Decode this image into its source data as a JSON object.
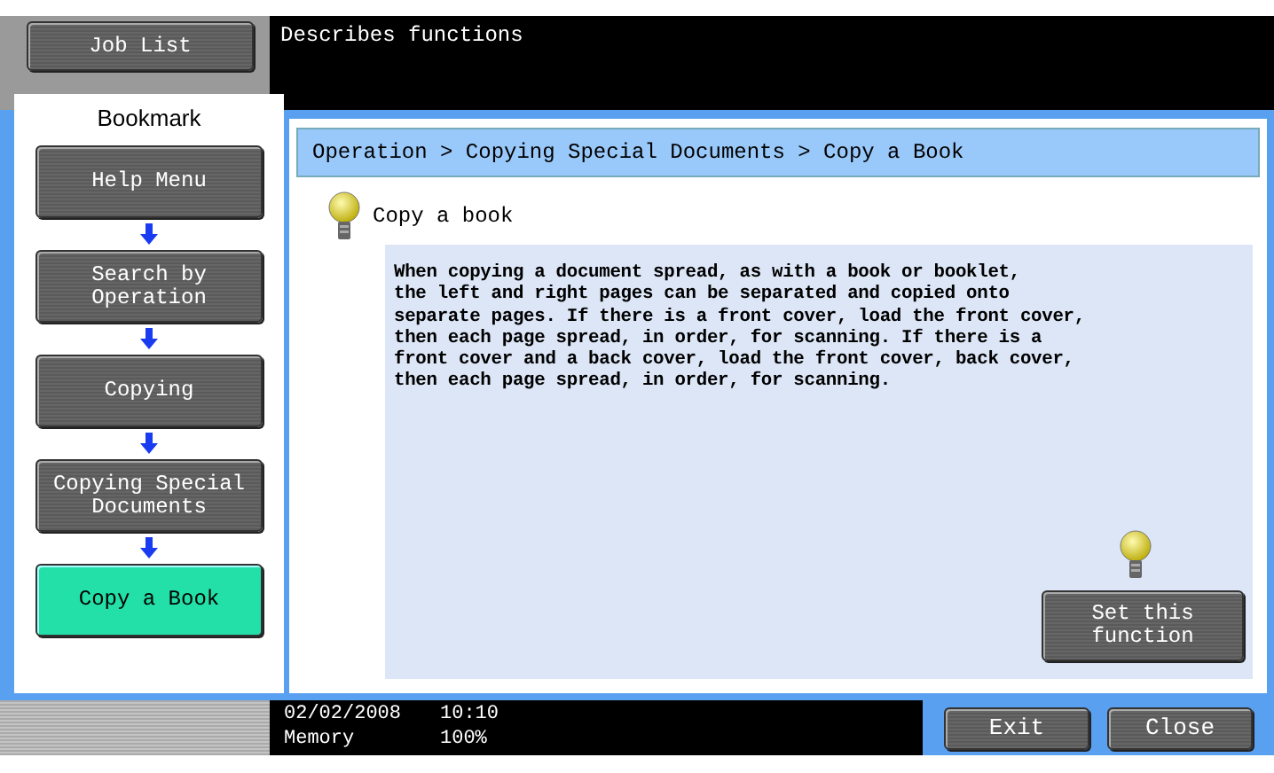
{
  "header": {
    "job_list_button": "Job List",
    "message": "Describes functions"
  },
  "sidebar": {
    "title": "Bookmark",
    "items": [
      {
        "label": "Help Menu",
        "selected": false
      },
      {
        "label": "Search by\nOperation",
        "selected": false
      },
      {
        "label": "Copying",
        "selected": false
      },
      {
        "label": "Copying Special\nDocuments",
        "selected": false
      },
      {
        "label": "Copy a Book",
        "selected": true
      }
    ]
  },
  "breadcrumb": "Operation > Copying Special Documents > Copy a Book",
  "topic": {
    "title": "Copy a book",
    "body": "When copying a document spread, as with a book or booklet,\nthe left and right pages can be separated and copied onto\nseparate pages. If there is a front cover, load the front cover,\nthen each page spread, in order, for scanning. If there is a\nfront cover and a back cover, load the front cover, back cover,\nthen each page spread, in order, for scanning.",
    "set_button": "Set this\nfunction"
  },
  "status_bar": {
    "date": "02/02/2008",
    "time": "10:10",
    "memory_label": "Memory",
    "memory_value": "100%"
  },
  "buttons": [
    "Exit",
    "Close"
  ]
}
